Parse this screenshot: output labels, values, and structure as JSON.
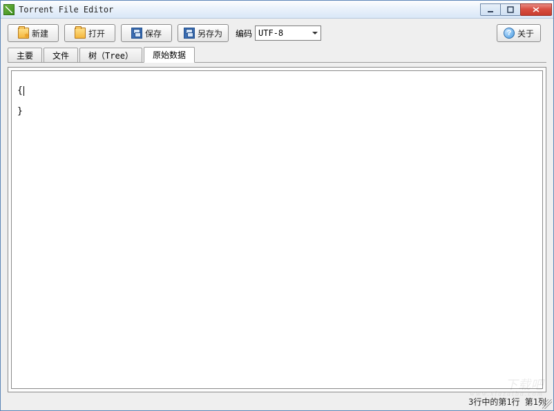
{
  "window": {
    "title": "Torrent File Editor"
  },
  "toolbar": {
    "new_label": "新建",
    "open_label": "打开",
    "save_label": "保存",
    "saveas_label": "另存为",
    "encoding_label": "编码",
    "encoding_value": "UTF-8",
    "about_label": "关于"
  },
  "tabs": [
    {
      "label": "主要"
    },
    {
      "label": "文件"
    },
    {
      "label": "树（Tree）"
    },
    {
      "label": "原始数据",
      "active": true
    }
  ],
  "editor": {
    "line1": "{",
    "line2": "",
    "line3": "}"
  },
  "statusbar": {
    "text": "3行中的第1行  第1列"
  },
  "watermark": {
    "line1": "下载吧",
    "line2": "www.xiazaiba.com"
  }
}
